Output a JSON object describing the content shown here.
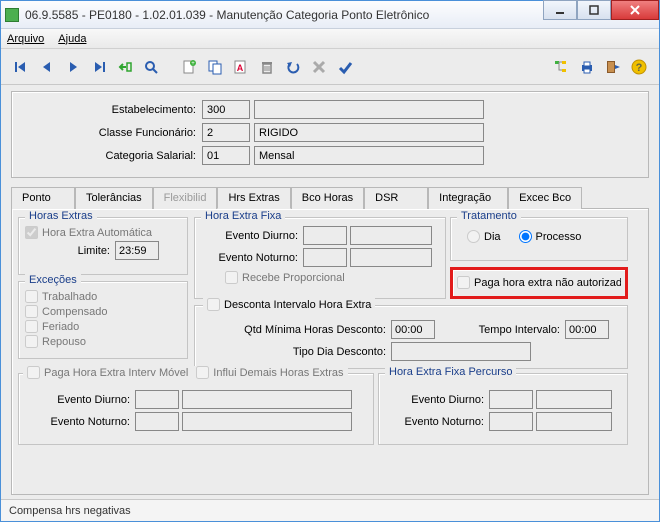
{
  "window": {
    "title": "06.9.5585 - PE0180 - 1.02.01.039 - Manutenção Categoria Ponto Eletrônico"
  },
  "menu": {
    "arquivo": "Arquivo",
    "ajuda": "Ajuda"
  },
  "header": {
    "estabelecimento_label": "Estabelecimento:",
    "estabelecimento_code": "300",
    "estabelecimento_desc": "",
    "classe_label": "Classe Funcionário:",
    "classe_code": "2",
    "classe_desc": "RIGIDO",
    "categoria_label": "Categoria Salarial:",
    "categoria_code": "01",
    "categoria_desc": "Mensal"
  },
  "tabs": {
    "ponto": "Ponto",
    "tolerancias": "Tolerâncias",
    "flexibilid": "Flexibilid",
    "hrsextras": "Hrs Extras",
    "bcohoras": "Bco Horas",
    "dsr": "DSR",
    "integracao": "Integração",
    "excecbco": "Excec Bco"
  },
  "groups": {
    "horas_extras": "Horas Extras",
    "hora_extra_fixa": "Hora Extra Fixa",
    "tratamento": "Tratamento",
    "excecoes": "Exceções",
    "hef_percurso": "Hora Extra Fixa Percurso"
  },
  "labels": {
    "hora_extra_auto": "Hora Extra Automática",
    "limite": "Limite:",
    "evento_diurno": "Evento Diurno:",
    "evento_noturno": "Evento Noturno:",
    "recebe_proporcional": "Recebe Proporcional",
    "dia": "Dia",
    "processo": "Processo",
    "paga_nao_autorizada": "Paga hora extra não autorizad",
    "trabalhado": "Trabalhado",
    "compensado": "Compensado",
    "feriado": "Feriado",
    "repouso": "Repouso",
    "desconta_intervalo": "Desconta Intervalo Hora Extra",
    "qtd_min_desc": "Qtd Mínima Horas Desconto:",
    "tempo_intervalo": "Tempo Intervalo:",
    "tipo_dia_desc": "Tipo Dia Desconto:",
    "paga_interv_movel": "Paga Hora Extra Interv Móvel",
    "influi_demais": "Influi Demais Horas Extras"
  },
  "values": {
    "limite": "23:59",
    "evento_diurno": "",
    "evento_diurno_desc": "",
    "evento_noturno": "",
    "evento_noturno_desc": "",
    "qtd_min": "00:00",
    "tempo_intervalo": "00:00",
    "tipo_dia_desc": "",
    "perc_ev_diurno": "",
    "perc_ev_diurno_desc": "",
    "perc_ev_noturno": "",
    "perc_ev_noturno_desc": "",
    "movel_ev_diurno": "",
    "movel_ev_diurno_desc": "",
    "movel_ev_noturno": "",
    "movel_ev_noturno_desc": ""
  },
  "status": "Compensa hrs negativas"
}
